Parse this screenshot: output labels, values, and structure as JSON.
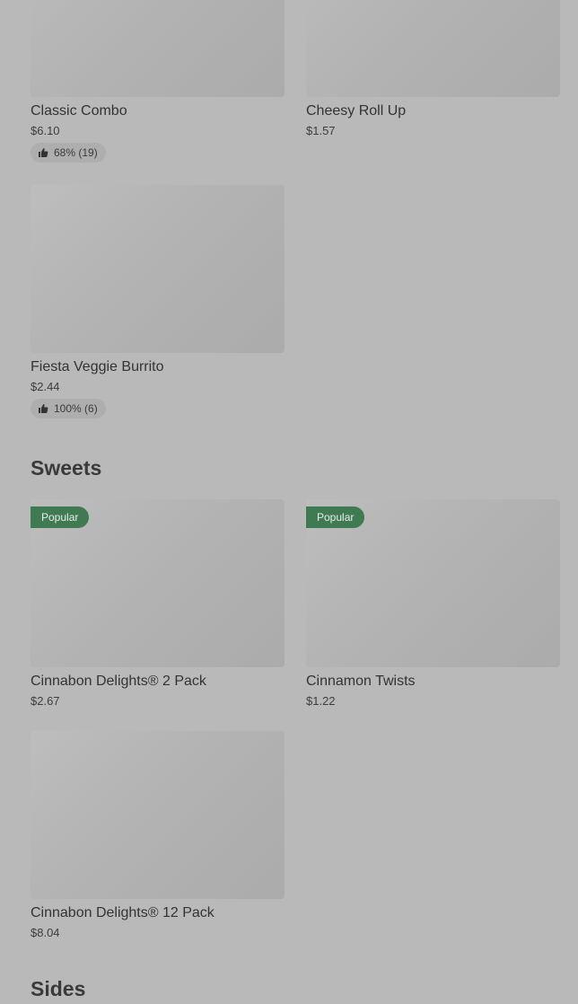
{
  "top_items": [
    {
      "name": "Classic Combo",
      "price": "$6.10",
      "rating": "68% (19)"
    },
    {
      "name": "Cheesy Roll Up",
      "price": "$1.57"
    },
    {
      "name": "Fiesta Veggie Burrito",
      "price": "$2.44",
      "rating": "100% (6)"
    }
  ],
  "sweets": {
    "title": "Sweets",
    "items": [
      {
        "badge": "Popular",
        "name": "Cinnabon Delights® 2 Pack",
        "price": "$2.67"
      },
      {
        "badge": "Popular",
        "name": "Cinnamon Twists",
        "price": "$1.22"
      },
      {
        "name": "Cinnabon Delights® 12 Pack",
        "price": "$8.04"
      }
    ]
  },
  "sides": {
    "title": "Sides"
  },
  "colors": {
    "overlay": "#b9b9b9",
    "badge": "#3f7a52"
  },
  "icons": {
    "rating": "thumbs-up-icon"
  }
}
